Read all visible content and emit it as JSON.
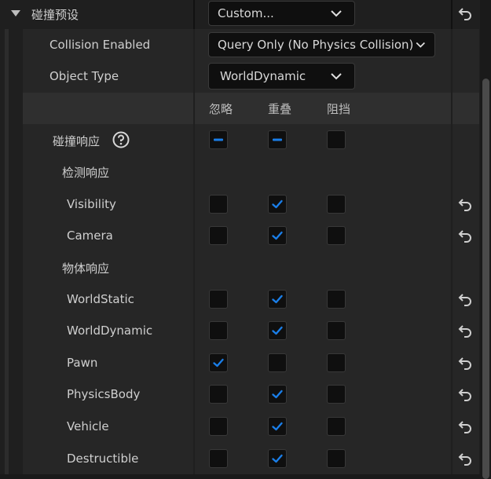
{
  "preset": {
    "label": "碰撞预设",
    "value": "Custom..."
  },
  "collision_enabled": {
    "label": "Collision Enabled",
    "value": "Query Only (No Physics Collision)"
  },
  "object_type": {
    "label": "Object Type",
    "value": "WorldDynamic"
  },
  "columns": [
    "忽略",
    "重叠",
    "阻挡"
  ],
  "responses": {
    "label": "碰撞响应",
    "help_icon": "help-circle-icon",
    "state": [
      "mixed",
      "mixed",
      "unchecked"
    ]
  },
  "trace_section": {
    "label": "检测响应"
  },
  "object_section": {
    "label": "物体响应"
  },
  "traces": [
    {
      "name": "Visibility",
      "state": [
        false,
        true,
        false
      ]
    },
    {
      "name": "Camera",
      "state": [
        false,
        true,
        false
      ]
    }
  ],
  "objects": [
    {
      "name": "WorldStatic",
      "state": [
        false,
        true,
        false
      ]
    },
    {
      "name": "WorldDynamic",
      "state": [
        false,
        true,
        false
      ]
    },
    {
      "name": "Pawn",
      "state": [
        true,
        false,
        false
      ]
    },
    {
      "name": "PhysicsBody",
      "state": [
        false,
        true,
        false
      ]
    },
    {
      "name": "Vehicle",
      "state": [
        false,
        true,
        false
      ]
    },
    {
      "name": "Destructible",
      "state": [
        false,
        true,
        false
      ]
    }
  ],
  "colors": {
    "accent": "#1a7ee8",
    "row_bg": "#262626",
    "field_bg": "#0f0f0f"
  }
}
